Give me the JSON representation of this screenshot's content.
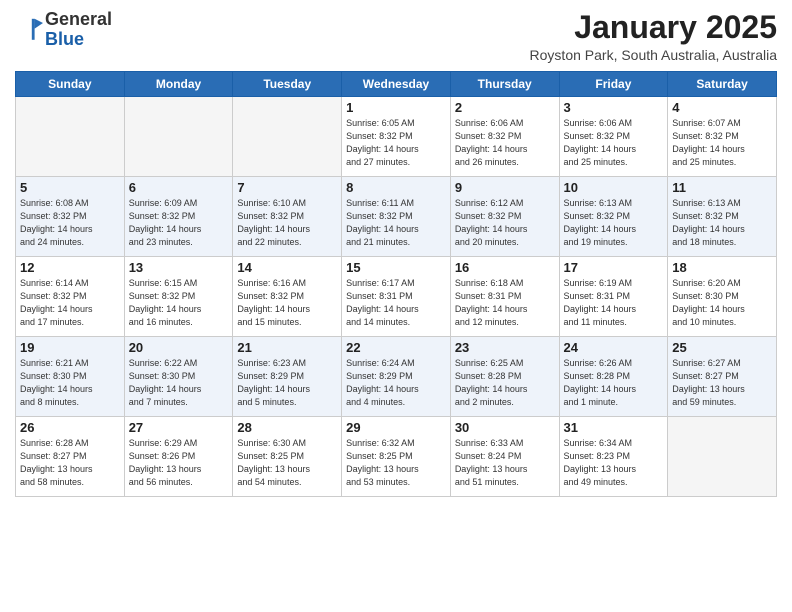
{
  "logo": {
    "text_general": "General",
    "text_blue": "Blue"
  },
  "header": {
    "month": "January 2025",
    "location": "Royston Park, South Australia, Australia"
  },
  "weekdays": [
    "Sunday",
    "Monday",
    "Tuesday",
    "Wednesday",
    "Thursday",
    "Friday",
    "Saturday"
  ],
  "weeks": [
    [
      {
        "day": "",
        "info": ""
      },
      {
        "day": "",
        "info": ""
      },
      {
        "day": "",
        "info": ""
      },
      {
        "day": "1",
        "info": "Sunrise: 6:05 AM\nSunset: 8:32 PM\nDaylight: 14 hours\nand 27 minutes."
      },
      {
        "day": "2",
        "info": "Sunrise: 6:06 AM\nSunset: 8:32 PM\nDaylight: 14 hours\nand 26 minutes."
      },
      {
        "day": "3",
        "info": "Sunrise: 6:06 AM\nSunset: 8:32 PM\nDaylight: 14 hours\nand 25 minutes."
      },
      {
        "day": "4",
        "info": "Sunrise: 6:07 AM\nSunset: 8:32 PM\nDaylight: 14 hours\nand 25 minutes."
      }
    ],
    [
      {
        "day": "5",
        "info": "Sunrise: 6:08 AM\nSunset: 8:32 PM\nDaylight: 14 hours\nand 24 minutes."
      },
      {
        "day": "6",
        "info": "Sunrise: 6:09 AM\nSunset: 8:32 PM\nDaylight: 14 hours\nand 23 minutes."
      },
      {
        "day": "7",
        "info": "Sunrise: 6:10 AM\nSunset: 8:32 PM\nDaylight: 14 hours\nand 22 minutes."
      },
      {
        "day": "8",
        "info": "Sunrise: 6:11 AM\nSunset: 8:32 PM\nDaylight: 14 hours\nand 21 minutes."
      },
      {
        "day": "9",
        "info": "Sunrise: 6:12 AM\nSunset: 8:32 PM\nDaylight: 14 hours\nand 20 minutes."
      },
      {
        "day": "10",
        "info": "Sunrise: 6:13 AM\nSunset: 8:32 PM\nDaylight: 14 hours\nand 19 minutes."
      },
      {
        "day": "11",
        "info": "Sunrise: 6:13 AM\nSunset: 8:32 PM\nDaylight: 14 hours\nand 18 minutes."
      }
    ],
    [
      {
        "day": "12",
        "info": "Sunrise: 6:14 AM\nSunset: 8:32 PM\nDaylight: 14 hours\nand 17 minutes."
      },
      {
        "day": "13",
        "info": "Sunrise: 6:15 AM\nSunset: 8:32 PM\nDaylight: 14 hours\nand 16 minutes."
      },
      {
        "day": "14",
        "info": "Sunrise: 6:16 AM\nSunset: 8:32 PM\nDaylight: 14 hours\nand 15 minutes."
      },
      {
        "day": "15",
        "info": "Sunrise: 6:17 AM\nSunset: 8:31 PM\nDaylight: 14 hours\nand 14 minutes."
      },
      {
        "day": "16",
        "info": "Sunrise: 6:18 AM\nSunset: 8:31 PM\nDaylight: 14 hours\nand 12 minutes."
      },
      {
        "day": "17",
        "info": "Sunrise: 6:19 AM\nSunset: 8:31 PM\nDaylight: 14 hours\nand 11 minutes."
      },
      {
        "day": "18",
        "info": "Sunrise: 6:20 AM\nSunset: 8:30 PM\nDaylight: 14 hours\nand 10 minutes."
      }
    ],
    [
      {
        "day": "19",
        "info": "Sunrise: 6:21 AM\nSunset: 8:30 PM\nDaylight: 14 hours\nand 8 minutes."
      },
      {
        "day": "20",
        "info": "Sunrise: 6:22 AM\nSunset: 8:30 PM\nDaylight: 14 hours\nand 7 minutes."
      },
      {
        "day": "21",
        "info": "Sunrise: 6:23 AM\nSunset: 8:29 PM\nDaylight: 14 hours\nand 5 minutes."
      },
      {
        "day": "22",
        "info": "Sunrise: 6:24 AM\nSunset: 8:29 PM\nDaylight: 14 hours\nand 4 minutes."
      },
      {
        "day": "23",
        "info": "Sunrise: 6:25 AM\nSunset: 8:28 PM\nDaylight: 14 hours\nand 2 minutes."
      },
      {
        "day": "24",
        "info": "Sunrise: 6:26 AM\nSunset: 8:28 PM\nDaylight: 14 hours\nand 1 minute."
      },
      {
        "day": "25",
        "info": "Sunrise: 6:27 AM\nSunset: 8:27 PM\nDaylight: 13 hours\nand 59 minutes."
      }
    ],
    [
      {
        "day": "26",
        "info": "Sunrise: 6:28 AM\nSunset: 8:27 PM\nDaylight: 13 hours\nand 58 minutes."
      },
      {
        "day": "27",
        "info": "Sunrise: 6:29 AM\nSunset: 8:26 PM\nDaylight: 13 hours\nand 56 minutes."
      },
      {
        "day": "28",
        "info": "Sunrise: 6:30 AM\nSunset: 8:25 PM\nDaylight: 13 hours\nand 54 minutes."
      },
      {
        "day": "29",
        "info": "Sunrise: 6:32 AM\nSunset: 8:25 PM\nDaylight: 13 hours\nand 53 minutes."
      },
      {
        "day": "30",
        "info": "Sunrise: 6:33 AM\nSunset: 8:24 PM\nDaylight: 13 hours\nand 51 minutes."
      },
      {
        "day": "31",
        "info": "Sunrise: 6:34 AM\nSunset: 8:23 PM\nDaylight: 13 hours\nand 49 minutes."
      },
      {
        "day": "",
        "info": ""
      }
    ]
  ]
}
